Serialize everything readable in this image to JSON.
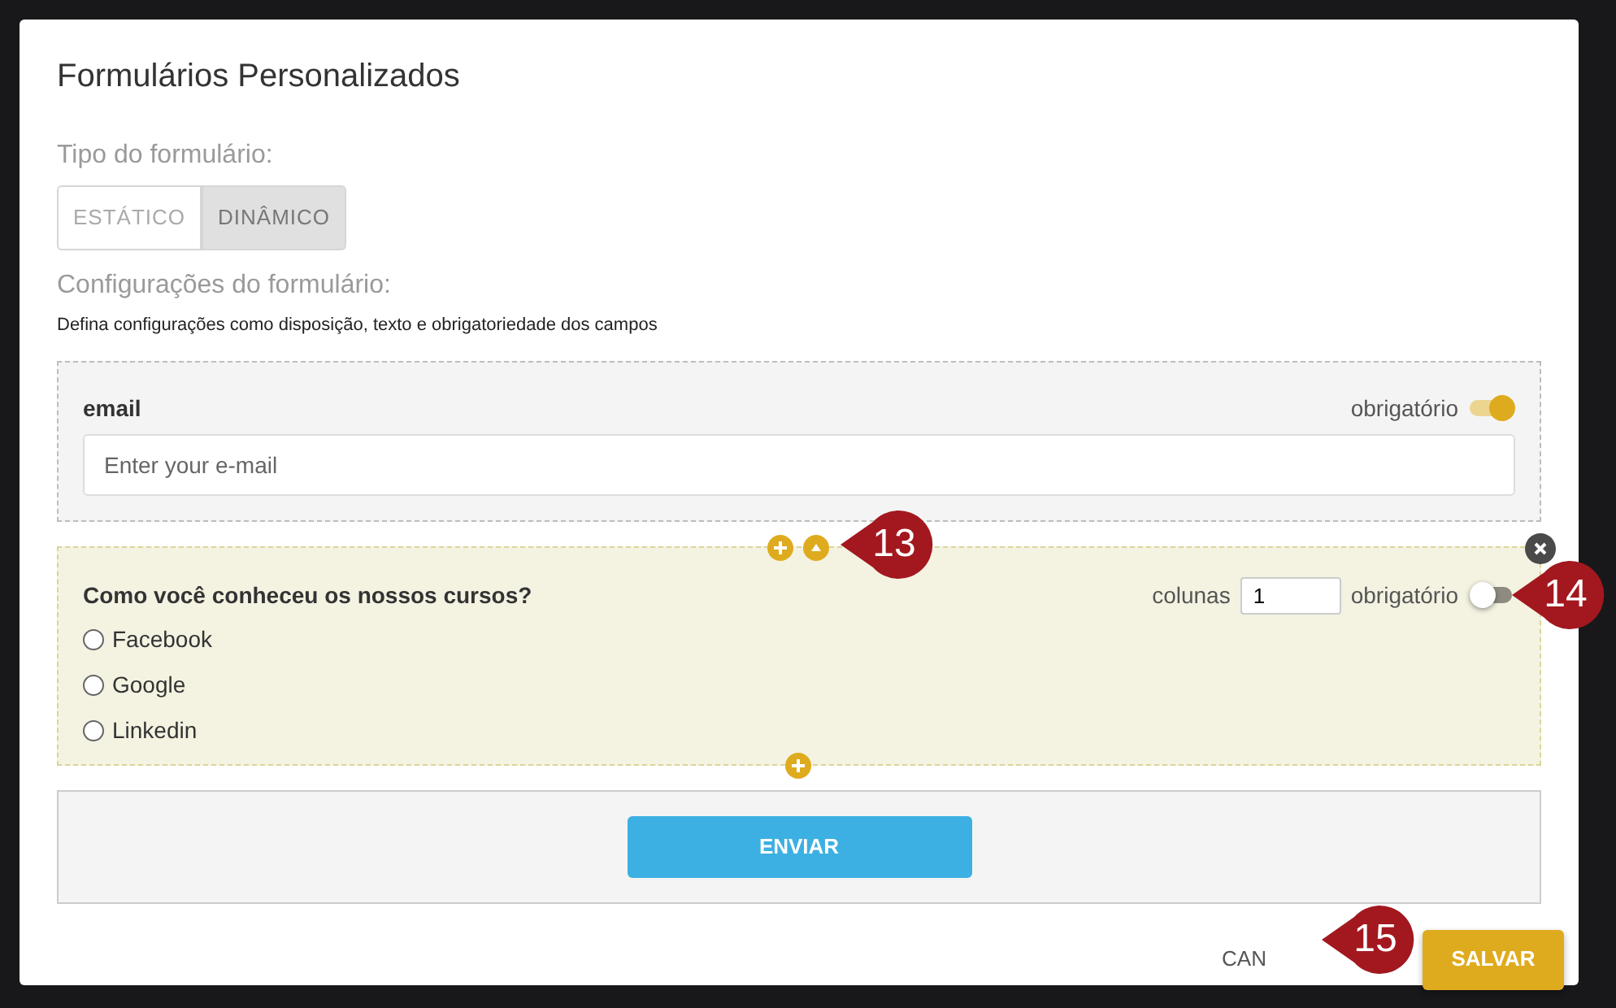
{
  "title": "Formulários Personalizados",
  "form_type": {
    "label": "Tipo do formulário:",
    "options": [
      {
        "label": "ESTÁTICO",
        "selected": false
      },
      {
        "label": "DINÂMICO",
        "selected": true
      }
    ]
  },
  "config": {
    "label": "Configurações do formulário:",
    "description": "Defina configurações como disposição, texto e obrigatoriedade dos campos"
  },
  "fields": [
    {
      "kind": "input",
      "label": "email",
      "required_label": "obrigatório",
      "required": true,
      "placeholder": "Enter your e-mail",
      "highlighted": false
    },
    {
      "kind": "radio",
      "label": "Como você conheceu os nossos cursos?",
      "columns_label": "colunas",
      "columns": "1",
      "required_label": "obrigatório",
      "required": false,
      "highlighted": true,
      "options": [
        {
          "label": "Facebook",
          "selected": false
        },
        {
          "label": "Google",
          "selected": false
        },
        {
          "label": "Linkedin",
          "selected": false
        }
      ]
    }
  ],
  "submit_button": "ENVIAR",
  "footer": {
    "cancel": "CAN",
    "save": "SALVAR"
  },
  "callouts": [
    "13",
    "14",
    "15"
  ]
}
